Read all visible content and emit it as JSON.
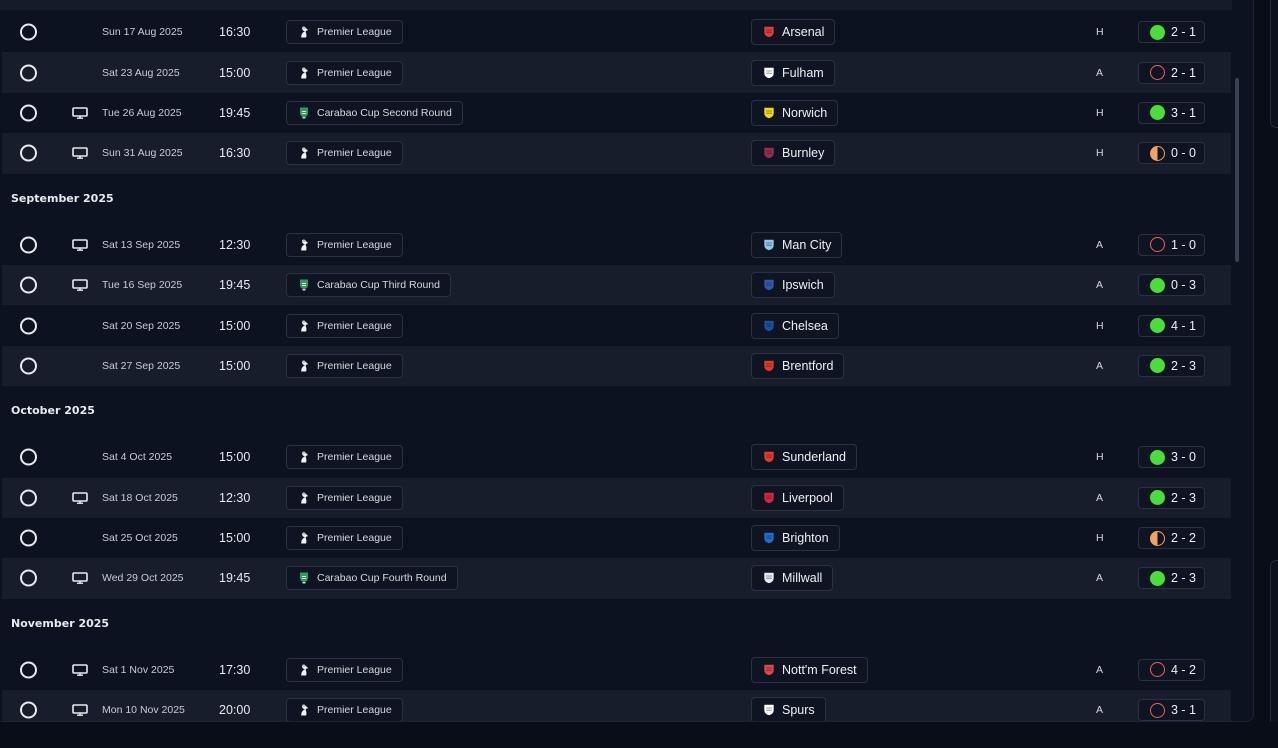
{
  "groups": [
    {
      "month": "",
      "rows": [
        {
          "tv": false,
          "date": "Sun 17 Aug 2025",
          "time": "16:30",
          "competition": "Premier League",
          "comp_icon": "premier-league-icon",
          "opponent": "Arsenal",
          "crest": "arsenal-crest-icon",
          "crest_color": "#e23c3a",
          "venue": "H",
          "outcome": "win",
          "score": "2 - 1"
        },
        {
          "tv": false,
          "date": "Sat 23 Aug 2025",
          "time": "15:00",
          "competition": "Premier League",
          "comp_icon": "premier-league-icon",
          "opponent": "Fulham",
          "crest": "fulham-crest-icon",
          "crest_color": "#ffffff",
          "venue": "A",
          "outcome": "loss",
          "score": "2 - 1"
        },
        {
          "tv": true,
          "date": "Tue 26 Aug 2025",
          "time": "19:45",
          "competition": "Carabao Cup Second Round",
          "comp_icon": "carabao-cup-icon",
          "opponent": "Norwich",
          "crest": "norwich-crest-icon",
          "crest_color": "#f5d90a",
          "venue": "H",
          "outcome": "win",
          "score": "3 - 1"
        },
        {
          "tv": true,
          "date": "Sun 31 Aug 2025",
          "time": "16:30",
          "competition": "Premier League",
          "comp_icon": "premier-league-icon",
          "opponent": "Burnley",
          "crest": "burnley-crest-icon",
          "crest_color": "#9b2b4b",
          "venue": "H",
          "outcome": "draw",
          "score": "0 - 0"
        }
      ]
    },
    {
      "month": "September 2025",
      "rows": [
        {
          "tv": true,
          "date": "Sat 13 Sep 2025",
          "time": "12:30",
          "competition": "Premier League",
          "comp_icon": "premier-league-icon",
          "opponent": "Man City",
          "crest": "man-city-crest-icon",
          "crest_color": "#8fc6ea",
          "venue": "A",
          "outcome": "loss",
          "score": "1 - 0"
        },
        {
          "tv": true,
          "date": "Tue 16 Sep 2025",
          "time": "19:45",
          "competition": "Carabao Cup Third Round",
          "comp_icon": "carabao-cup-icon",
          "opponent": "Ipswich",
          "crest": "ipswich-crest-icon",
          "crest_color": "#3458b0",
          "venue": "A",
          "outcome": "win",
          "score": "0 - 3"
        },
        {
          "tv": false,
          "date": "Sat 20 Sep 2025",
          "time": "15:00",
          "competition": "Premier League",
          "comp_icon": "premier-league-icon",
          "opponent": "Chelsea",
          "crest": "chelsea-crest-icon",
          "crest_color": "#1d4fa0",
          "venue": "H",
          "outcome": "win",
          "score": "4 - 1"
        },
        {
          "tv": false,
          "date": "Sat 27 Sep 2025",
          "time": "15:00",
          "competition": "Premier League",
          "comp_icon": "premier-league-icon",
          "opponent": "Brentford",
          "crest": "brentford-crest-icon",
          "crest_color": "#e03a2f",
          "venue": "A",
          "outcome": "win",
          "score": "2 - 3"
        }
      ]
    },
    {
      "month": "October 2025",
      "rows": [
        {
          "tv": false,
          "date": "Sat 4 Oct 2025",
          "time": "15:00",
          "competition": "Premier League",
          "comp_icon": "premier-league-icon",
          "opponent": "Sunderland",
          "crest": "sunderland-crest-icon",
          "crest_color": "#e63b2e",
          "venue": "H",
          "outcome": "win",
          "score": "3 - 0"
        },
        {
          "tv": true,
          "date": "Sat 18 Oct 2025",
          "time": "12:30",
          "competition": "Premier League",
          "comp_icon": "premier-league-icon",
          "opponent": "Liverpool",
          "crest": "liverpool-crest-icon",
          "crest_color": "#d7263d",
          "venue": "A",
          "outcome": "win",
          "score": "2 - 3"
        },
        {
          "tv": false,
          "date": "Sat 25 Oct 2025",
          "time": "15:00",
          "competition": "Premier League",
          "comp_icon": "premier-league-icon",
          "opponent": "Brighton",
          "crest": "brighton-crest-icon",
          "crest_color": "#1d6fd1",
          "venue": "H",
          "outcome": "draw",
          "score": "2 - 2"
        },
        {
          "tv": true,
          "date": "Wed 29 Oct 2025",
          "time": "19:45",
          "competition": "Carabao Cup Fourth Round",
          "comp_icon": "carabao-cup-icon",
          "opponent": "Millwall",
          "crest": "millwall-crest-icon",
          "crest_color": "#e8eaf0",
          "venue": "A",
          "outcome": "win",
          "score": "2 - 3"
        }
      ]
    },
    {
      "month": "November 2025",
      "rows": [
        {
          "tv": true,
          "date": "Sat 1 Nov 2025",
          "time": "17:30",
          "competition": "Premier League",
          "comp_icon": "premier-league-icon",
          "opponent": "Nott'm Forest",
          "crest": "nottm-forest-crest-icon",
          "crest_color": "#e04848",
          "venue": "A",
          "outcome": "loss",
          "score": "4 - 2"
        },
        {
          "tv": true,
          "date": "Mon 10 Nov 2025",
          "time": "20:00",
          "competition": "Premier League",
          "comp_icon": "premier-league-icon",
          "opponent": "Spurs",
          "crest": "spurs-crest-icon",
          "crest_color": "#ffffff",
          "venue": "A",
          "outcome": "loss",
          "score": "3 - 1"
        }
      ]
    }
  ],
  "colors": {
    "win": "#4ade3a",
    "loss": "#f0605a",
    "draw": "#f4a261",
    "row_alt": "#171d2b",
    "background": "#0d1220"
  }
}
